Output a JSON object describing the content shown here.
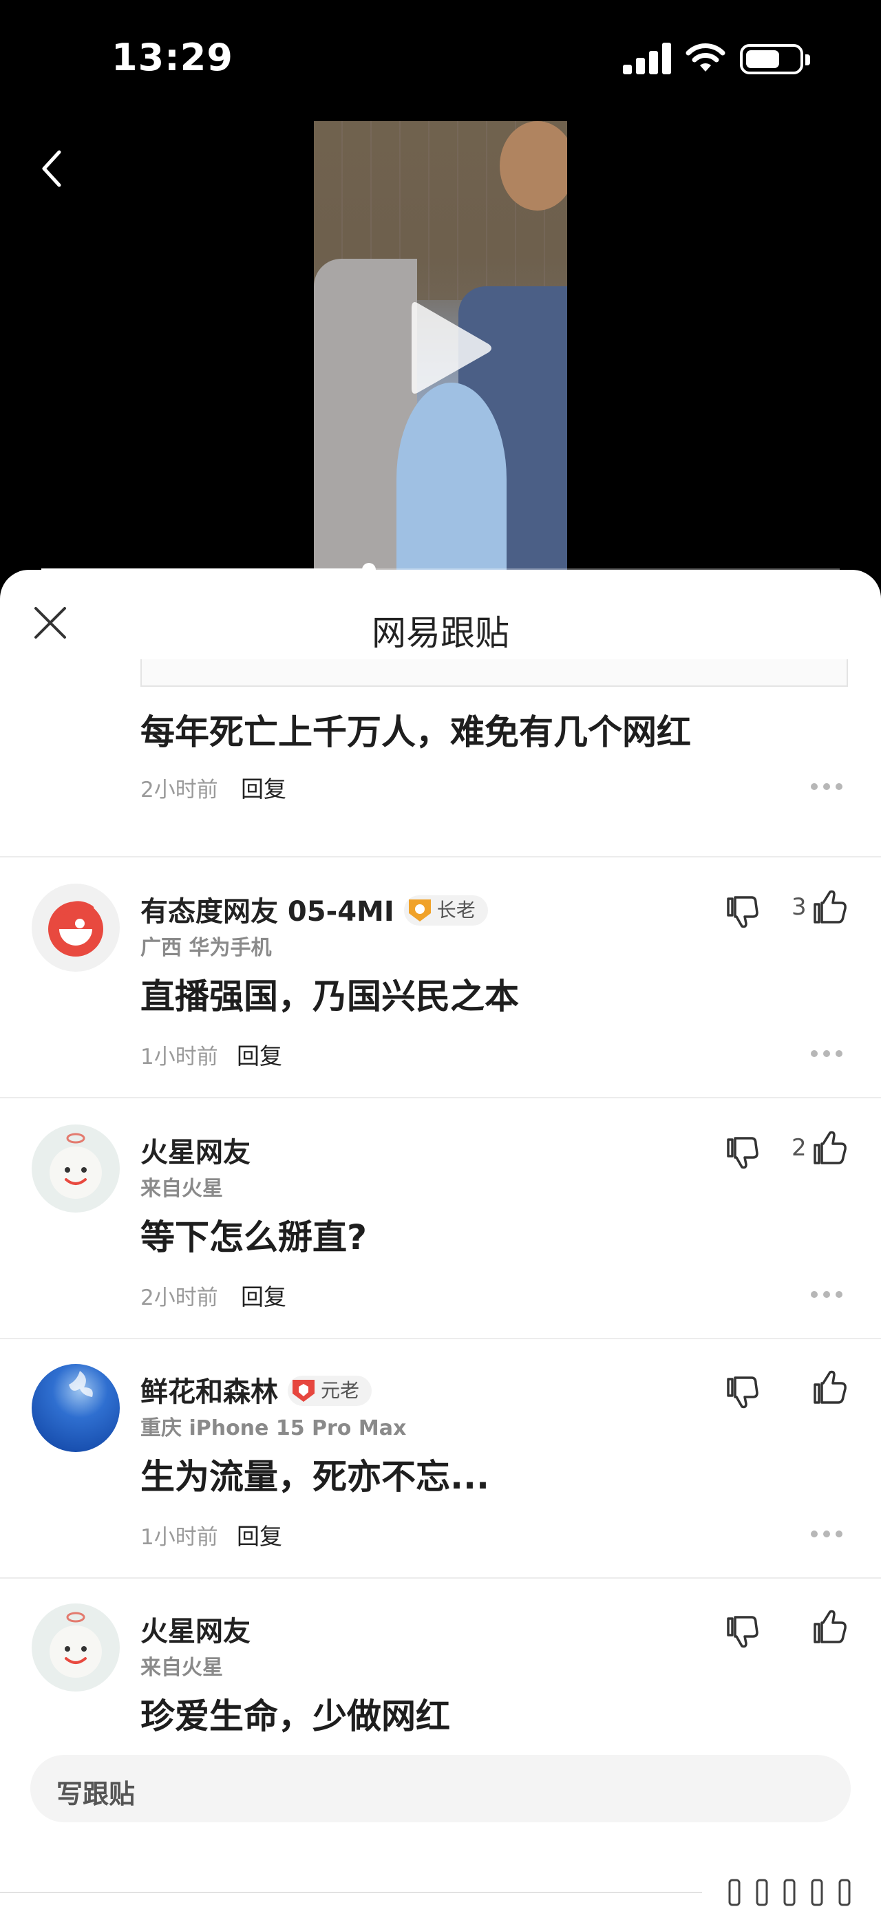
{
  "status_bar": {
    "time": "13:29"
  },
  "video": {
    "progress": 0.41
  },
  "sheet": {
    "title": "网易跟贴",
    "write_placeholder": "写跟贴"
  },
  "first_comment": {
    "content": "每年死亡上千万人，难免有几个网红",
    "time": "2小时前",
    "reply": "回复"
  },
  "comments": [
    {
      "username": "有态度网友 05-4MI",
      "badge": "长老",
      "meta": "广西  华为手机",
      "content": "直播强国，乃国兴民之本",
      "time": "1小时前",
      "reply": "回复",
      "likes": "3",
      "avatar_icon": "red-swirl-avatar-icon"
    },
    {
      "username": "火星网友",
      "badge": "",
      "meta": "来自火星",
      "content": "等下怎么掰直?",
      "time": "2小时前",
      "reply": "回复",
      "likes": "2",
      "avatar_icon": "mars-smiley-avatar-icon"
    },
    {
      "username": "鲜花和森林",
      "badge": "元老",
      "meta": "重庆  iPhone 15 Pro Max",
      "content": "生为流量，死亦不忘...",
      "time": "1小时前",
      "reply": "回复",
      "likes": "",
      "avatar_icon": "blue-sky-avatar-icon"
    },
    {
      "username": "火星网友",
      "badge": "",
      "meta": "来自火星",
      "content": "珍爱生命，少做网红",
      "time": "",
      "reply": "",
      "likes": "",
      "avatar_icon": "mars-smiley-avatar-icon"
    }
  ],
  "colors": {
    "badge_gold": "#f0a22a",
    "badge_red": "#e6463e",
    "accent_red": "#e8493f"
  }
}
